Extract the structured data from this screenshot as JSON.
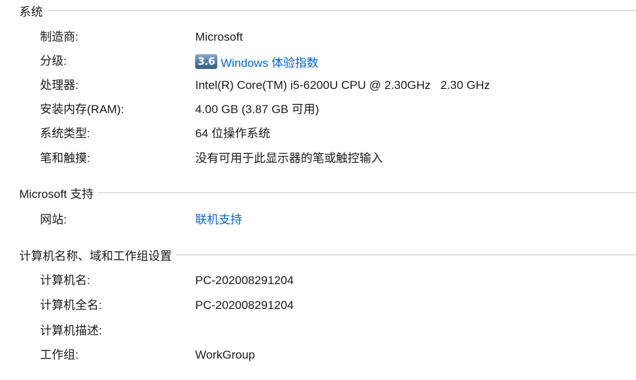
{
  "system": {
    "title": "系统",
    "rows": [
      {
        "label": "制造商:",
        "value": "Microsoft"
      },
      {
        "label": "分级:",
        "rating_score": "3.6",
        "rating_link": "Windows 体验指数"
      },
      {
        "label": "处理器:",
        "value": "Intel(R) Core(TM) i5-6200U CPU @ 2.30GHz   2.30 GHz"
      },
      {
        "label": "安装内存(RAM):",
        "value": "4.00 GB (3.87 GB 可用)"
      },
      {
        "label": "系统类型:",
        "value": "64 位操作系统"
      },
      {
        "label": "笔和触摸:",
        "value": "没有可用于此显示器的笔或触控输入"
      }
    ]
  },
  "support": {
    "title": "Microsoft 支持",
    "rows": [
      {
        "label": "网站:",
        "link": "联机支持"
      }
    ]
  },
  "computer": {
    "title": "计算机名称、域和工作组设置",
    "rows": [
      {
        "label": "计算机名:",
        "value": "PC-202008291204"
      },
      {
        "label": "计算机全名:",
        "value": "PC-202008291204"
      },
      {
        "label": "计算机描述:",
        "value": ""
      },
      {
        "label": "工作组:",
        "value": "WorkGroup"
      }
    ]
  },
  "colors": {
    "link": "#0066cc",
    "separator": "#c8c8c8"
  }
}
